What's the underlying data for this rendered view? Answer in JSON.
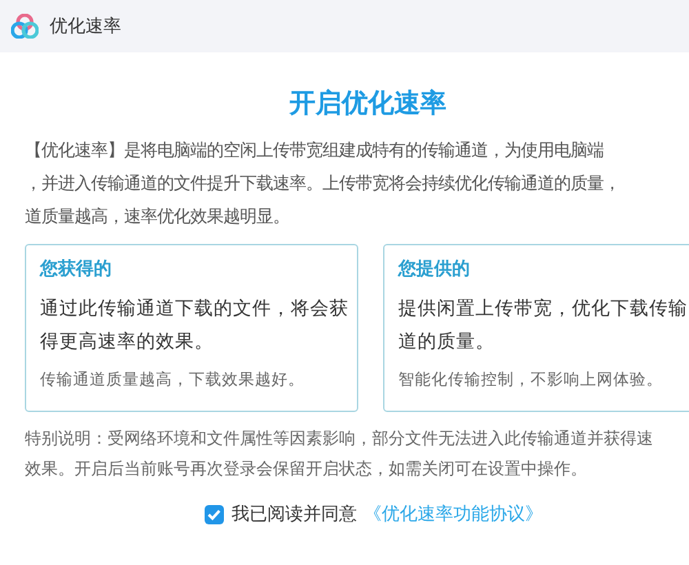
{
  "window": {
    "title": "优化速率"
  },
  "heading": "开启优化速率",
  "intro_lines": [
    "【优化速率】是将电脑端的空闲上传带宽组建成特有的传输通道，为使用电脑端",
    "，并进入传输通道的文件提升下载速率。上传带宽将会持续优化传输通道的质量，",
    "道质量越高，速率优化效果越明显。"
  ],
  "cards": [
    {
      "title": "您获得的",
      "body_lines": [
        "通过此传输通道下载的文件，将会获",
        "得更高速率的效果。"
      ],
      "footer": "传输通道质量越高，下载效果越好。"
    },
    {
      "title": "您提供的",
      "body_lines": [
        "提供闲置上传带宽，优化下载传输",
        "道的质量。"
      ],
      "footer": "智能化传输控制，不影响上网体验。"
    }
  ],
  "note_lines": [
    "特别说明：受网络环境和文件属性等因素影响，部分文件无法进入此传输通道并获得速",
    "效果。开启后当前账号再次登录会保留开启状态，如需关闭可在设置中操作。"
  ],
  "agreement": {
    "checked": true,
    "label": "我已阅读并同意",
    "link": "《优化速率功能协议》"
  }
}
